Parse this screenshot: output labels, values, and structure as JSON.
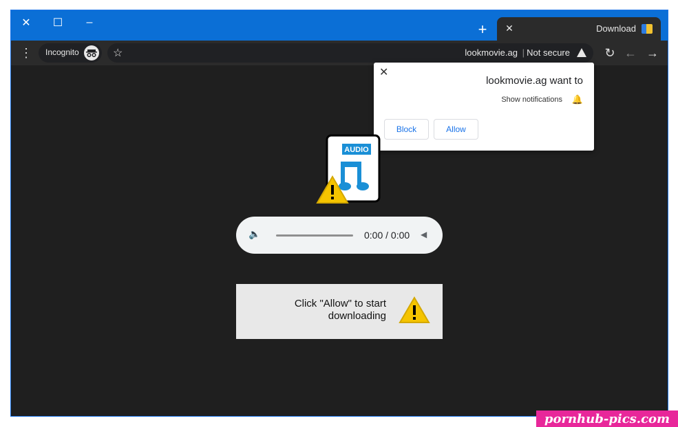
{
  "window": {
    "tab_title": "Download",
    "controls": {
      "close": "✕",
      "maximize": "☐",
      "minimize": "–"
    },
    "new_tab": "+"
  },
  "toolbar": {
    "incognito_label": "Incognito",
    "security_label": "Not secure",
    "url": "lookmovie.ag",
    "separator": "|"
  },
  "notification_popup": {
    "title": "lookmovie.ag want to",
    "permission": "Show notifications",
    "allow_label": "Allow",
    "block_label": "Block"
  },
  "audio_player": {
    "time": "0:00 / 0:00"
  },
  "file_icon": {
    "badge": "AUDIO"
  },
  "message": {
    "text": "Click \"Allow\" to start downloading"
  },
  "watermark": "pornhub-pics.com",
  "colors": {
    "titlebar": "#0b6fd6",
    "accent": "#1a73e8",
    "page_bg": "#1f1f1f",
    "warning_yellow": "#f5c400"
  },
  "icons": [
    "close-icon",
    "maximize-icon",
    "minimize-icon",
    "plus-icon",
    "back-arrow-icon",
    "forward-arrow-icon",
    "reload-icon",
    "star-icon",
    "menu-dots-icon",
    "incognito-icon",
    "warning-icon",
    "bell-icon",
    "play-icon",
    "volume-icon",
    "music-note-icon"
  ]
}
